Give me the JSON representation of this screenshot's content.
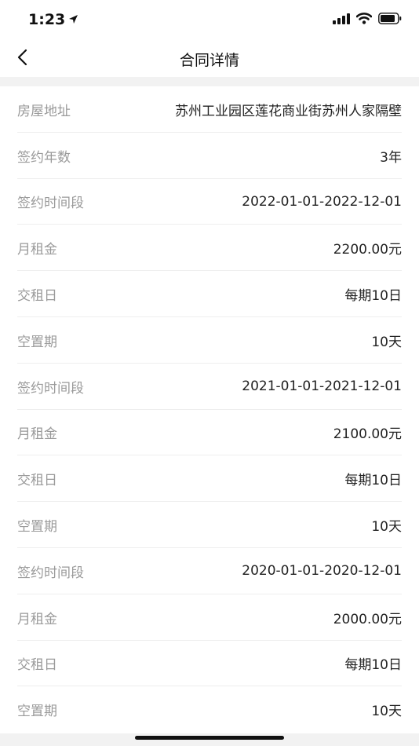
{
  "status_bar": {
    "time": "1:23"
  },
  "nav": {
    "title": "合同详情"
  },
  "details": [
    {
      "label": "房屋地址",
      "value": "苏州工业园区莲花商业街苏州人家隔壁"
    },
    {
      "label": "签约年数",
      "value": "3年"
    },
    {
      "label": "签约时间段",
      "value": "2022-01-01-2022-12-01"
    },
    {
      "label": "月租金",
      "value": "2200.00元"
    },
    {
      "label": "交租日",
      "value": "每期10日"
    },
    {
      "label": "空置期",
      "value": "10天"
    },
    {
      "label": "签约时间段",
      "value": "2021-01-01-2021-12-01"
    },
    {
      "label": "月租金",
      "value": "2100.00元"
    },
    {
      "label": "交租日",
      "value": "每期10日"
    },
    {
      "label": "空置期",
      "value": "10天"
    },
    {
      "label": "签约时间段",
      "value": "2020-01-01-2020-12-01"
    },
    {
      "label": "月租金",
      "value": "2000.00元"
    },
    {
      "label": "交租日",
      "value": "每期10日"
    },
    {
      "label": "空置期",
      "value": "10天"
    }
  ]
}
